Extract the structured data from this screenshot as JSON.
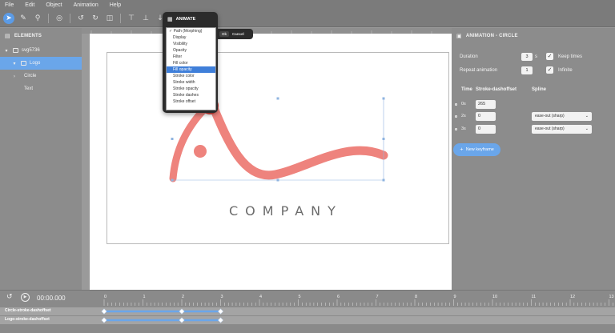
{
  "menu": [
    "File",
    "Edit",
    "Object",
    "Animation",
    "Help"
  ],
  "elements_panel": {
    "title": "ELEMENTS",
    "tree": [
      {
        "label": "svg5736",
        "level": 0,
        "caret": "▾",
        "selected": false
      },
      {
        "label": "Logo",
        "level": 1,
        "caret": "▾",
        "selected": true
      },
      {
        "label": "Circle",
        "level": 2,
        "caret": "›",
        "selected": false
      },
      {
        "label": "Text",
        "level": 2,
        "caret": "",
        "selected": false
      }
    ]
  },
  "canvas": {
    "company_text": "COMPANY",
    "accent_color": "#ee837d"
  },
  "animate_popup": {
    "title": "ANIMATE",
    "options": [
      "✓ Path (Morphing)",
      "Display",
      "Visibility",
      "Opacity",
      "Filter",
      "Fill color",
      "Fill opacity",
      "Stroke color",
      "Stroke width",
      "Stroke opacity",
      "Stroke dashes",
      "Stroke offset"
    ],
    "highlighted": "Fill opacity",
    "ok_label": "Ok",
    "cancel_label": "Cancel"
  },
  "animation_panel": {
    "title": "ANIMATION - CIRCLE",
    "duration_label": "Duration",
    "duration_value": "3",
    "duration_unit": "s",
    "keep_times_label": "Keep times",
    "repeat_label": "Repeat animation",
    "repeat_value": "1",
    "infinite_label": "Infinite",
    "table_headers": {
      "time": "Time",
      "property": "Stroke-dashoffset",
      "spline": "Spline"
    },
    "keyframes": [
      {
        "time": "0s",
        "value": "265",
        "spline": ""
      },
      {
        "time": "2s",
        "value": "0",
        "spline": "ease-out (sharp)"
      },
      {
        "time": "3s",
        "value": "0",
        "spline": "ease-out (sharp)"
      }
    ],
    "new_keyframe_label": "New keyframe"
  },
  "timeline": {
    "timecode": "00:00.000",
    "ticks": [
      "0",
      "1",
      "2",
      "3",
      "4",
      "5",
      "6",
      "7",
      "8",
      "9",
      "10",
      "11",
      "12",
      "13"
    ],
    "tracks": [
      {
        "label": "Circle-stroke-dashoffset",
        "keyframes_s": [
          0,
          2,
          3
        ]
      },
      {
        "label": "Logo-stroke-dashoffset",
        "keyframes_s": [
          0,
          2,
          3
        ]
      }
    ]
  },
  "colors": {
    "accent_blue": "#6aa6ea",
    "logo_coral": "#ee837d",
    "logo_dark_red": "#d9322a"
  }
}
